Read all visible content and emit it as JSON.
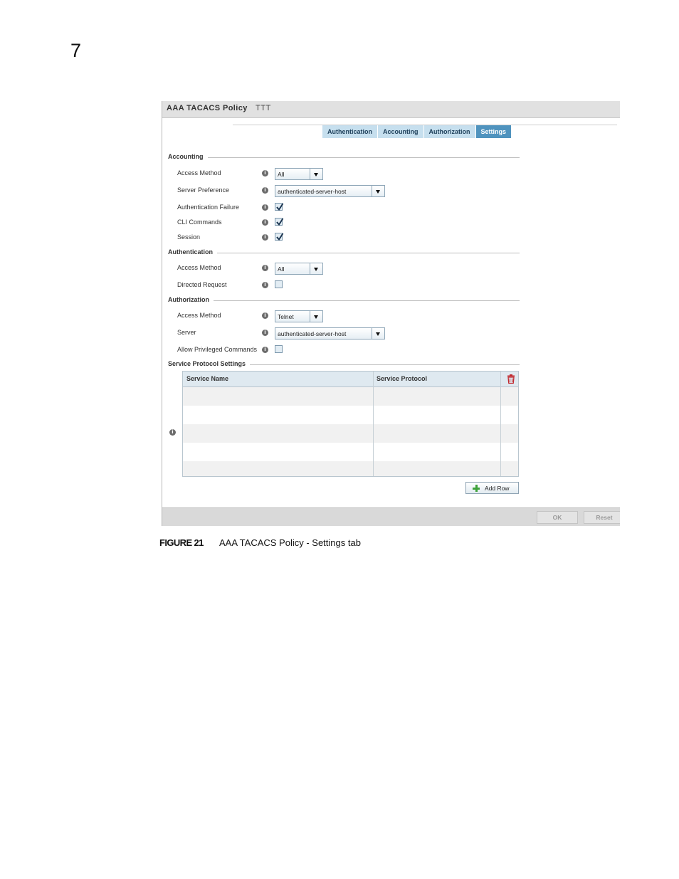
{
  "page": {
    "chapter_number": "7"
  },
  "window": {
    "title": "AAA TACACS Policy",
    "policy_name": "TTT"
  },
  "tabs": [
    {
      "label": "Authentication",
      "active": false
    },
    {
      "label": "Accounting",
      "active": false
    },
    {
      "label": "Authorization",
      "active": false
    },
    {
      "label": "Settings",
      "active": true
    }
  ],
  "accounting": {
    "heading": "Accounting",
    "access_method": {
      "label": "Access Method",
      "value": "All"
    },
    "server_preference": {
      "label": "Server Preference",
      "value": "authenticated-server-host"
    },
    "authentication_failure": {
      "label": "Authentication Failure",
      "checked": true
    },
    "cli_commands": {
      "label": "CLI Commands",
      "checked": true
    },
    "session": {
      "label": "Session",
      "checked": true
    }
  },
  "authentication": {
    "heading": "Authentication",
    "access_method": {
      "label": "Access Method",
      "value": "All"
    },
    "directed_request": {
      "label": "Directed Request",
      "checked": false
    }
  },
  "authorization": {
    "heading": "Authorization",
    "access_method": {
      "label": "Access Method",
      "value": "Telnet"
    },
    "server": {
      "label": "Server",
      "value": "authenticated-server-host"
    },
    "allow_privileged_commands": {
      "label": "Allow Privileged Commands",
      "checked": false
    }
  },
  "service_protocol": {
    "heading": "Service Protocol Settings",
    "columns": [
      "Service Name",
      "Service Protocol"
    ],
    "rows": [],
    "add_row_label": "Add Row"
  },
  "footer": {
    "ok_label": "OK",
    "reset_label": "Reset"
  },
  "icons": {
    "info": "info-icon",
    "delete": "trash-icon",
    "add": "plus-icon",
    "dropdown": "chevron-down-icon",
    "checkmark": "checkmark-icon"
  },
  "colors": {
    "active_tab": "#4f93be",
    "inactive_tab": "#c6dfee",
    "trash": "#c0282d",
    "add": "#3fa23a"
  },
  "caption": {
    "figure": "FIGURE 21",
    "text": "AAA TACACS Policy - Settings tab"
  }
}
